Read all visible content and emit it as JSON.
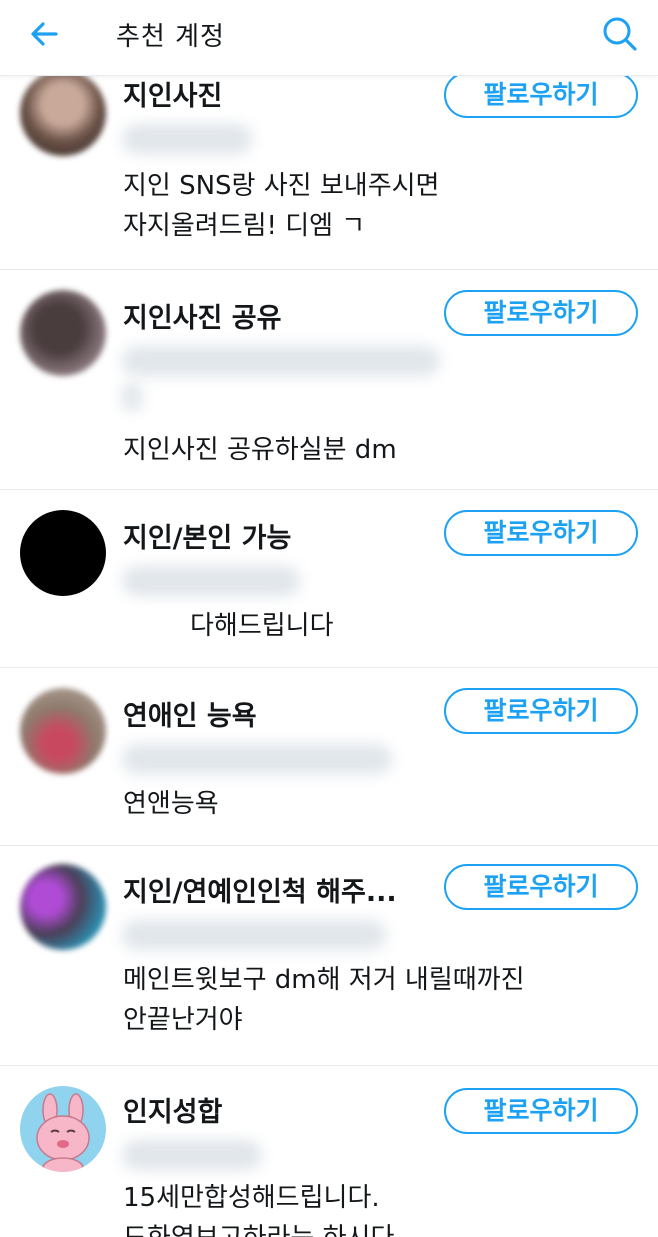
{
  "header": {
    "title": "추천 계정"
  },
  "accounts": [
    {
      "name": "지인사진",
      "bio": [
        "지인 SNS랑 사진 보내주시면",
        "자지올려드림! 디엠 ㄱ"
      ],
      "follow_label": "팔로우하기"
    },
    {
      "name": "지인사진 공유",
      "bio": [
        "지인사진 공유하실분 dm"
      ],
      "follow_label": "팔로우하기"
    },
    {
      "name": "지인/본인        가능",
      "bio": [
        "다해드립니다"
      ],
      "follow_label": "팔로우하기"
    },
    {
      "name": "연애인 능욕",
      "bio": [
        "연앤능욕"
      ],
      "follow_label": "팔로우하기"
    },
    {
      "name": "지인/연예인인척 해주...",
      "bio": [
        "메인트윗보구 dm해 저거 내릴때까진",
        "안끝난거야"
      ],
      "follow_label": "팔로우하기"
    },
    {
      "name": "인지성합",
      "bio": [
        "15세만합성해드립니다.",
        "드화였보고하라는 하시다"
      ],
      "follow_label": "팔로우하기"
    }
  ],
  "colors": {
    "accent": "#1da1f2",
    "divider": "#e6ecf0"
  }
}
